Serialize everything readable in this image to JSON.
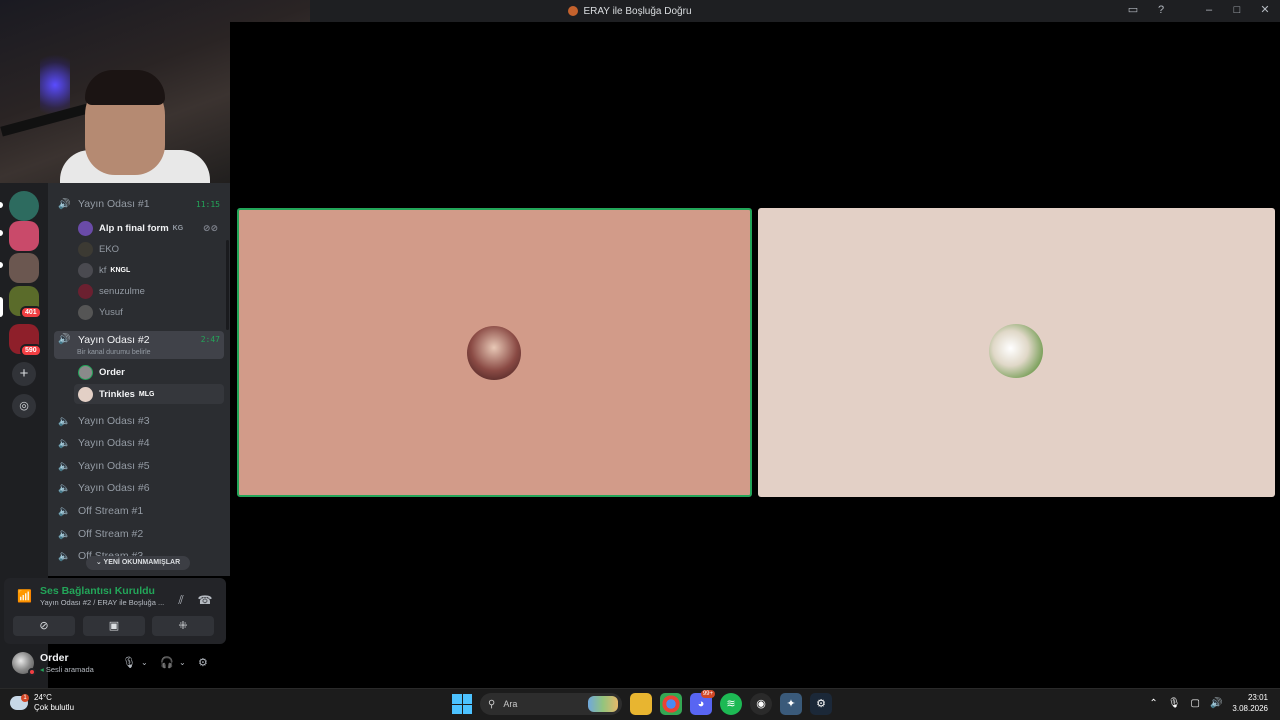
{
  "window": {
    "title": "ERAY ile Boşluğa Doğru"
  },
  "servers": {
    "badges": [
      "401",
      "590"
    ]
  },
  "channels": {
    "voice": [
      {
        "name": "Yayın Odası #1",
        "duration": "11:15"
      },
      {
        "name": "Yayın Odası #2",
        "duration": "2:47",
        "status": "Bir kanal durumu belirle"
      },
      {
        "name": "Yayın Odası #3"
      },
      {
        "name": "Yayın Odası #4"
      },
      {
        "name": "Yayın Odası #5"
      },
      {
        "name": "Yayın Odası #6"
      },
      {
        "name": "Off Stream #1"
      },
      {
        "name": "Off Stream #2"
      },
      {
        "name": "Off Stream #3"
      }
    ],
    "room1_users": [
      {
        "name": "Alp n final form",
        "tag": "KG"
      },
      {
        "name": "EKO"
      },
      {
        "name": "kf",
        "tag": "KNGL"
      },
      {
        "name": "senuzulme"
      },
      {
        "name": "Yusuf"
      }
    ],
    "room2_users": [
      {
        "name": "Order"
      },
      {
        "name": "Trinkles",
        "tag": "MLG"
      }
    ],
    "unread_label": "YENİ OKUNMAMIŞLAR"
  },
  "voice_panel": {
    "title": "Ses Bağlantısı Kuruldu",
    "subtitle": "Yayın Odası #2 / ERAY ile Boşluğa ..."
  },
  "user_panel": {
    "name": "Order",
    "status": "Sesli aramada"
  },
  "taskbar": {
    "weather_temp": "24°C",
    "weather_cond": "Çok bulutlu",
    "weather_badge": "1",
    "search_label": "Ara",
    "discord_badge": "99+",
    "time": "23:01",
    "date": "3.08.2026"
  },
  "colors": {
    "accent_green": "#23a559",
    "tile_left": "#d29b89",
    "tile_right": "#e3d0c6"
  }
}
